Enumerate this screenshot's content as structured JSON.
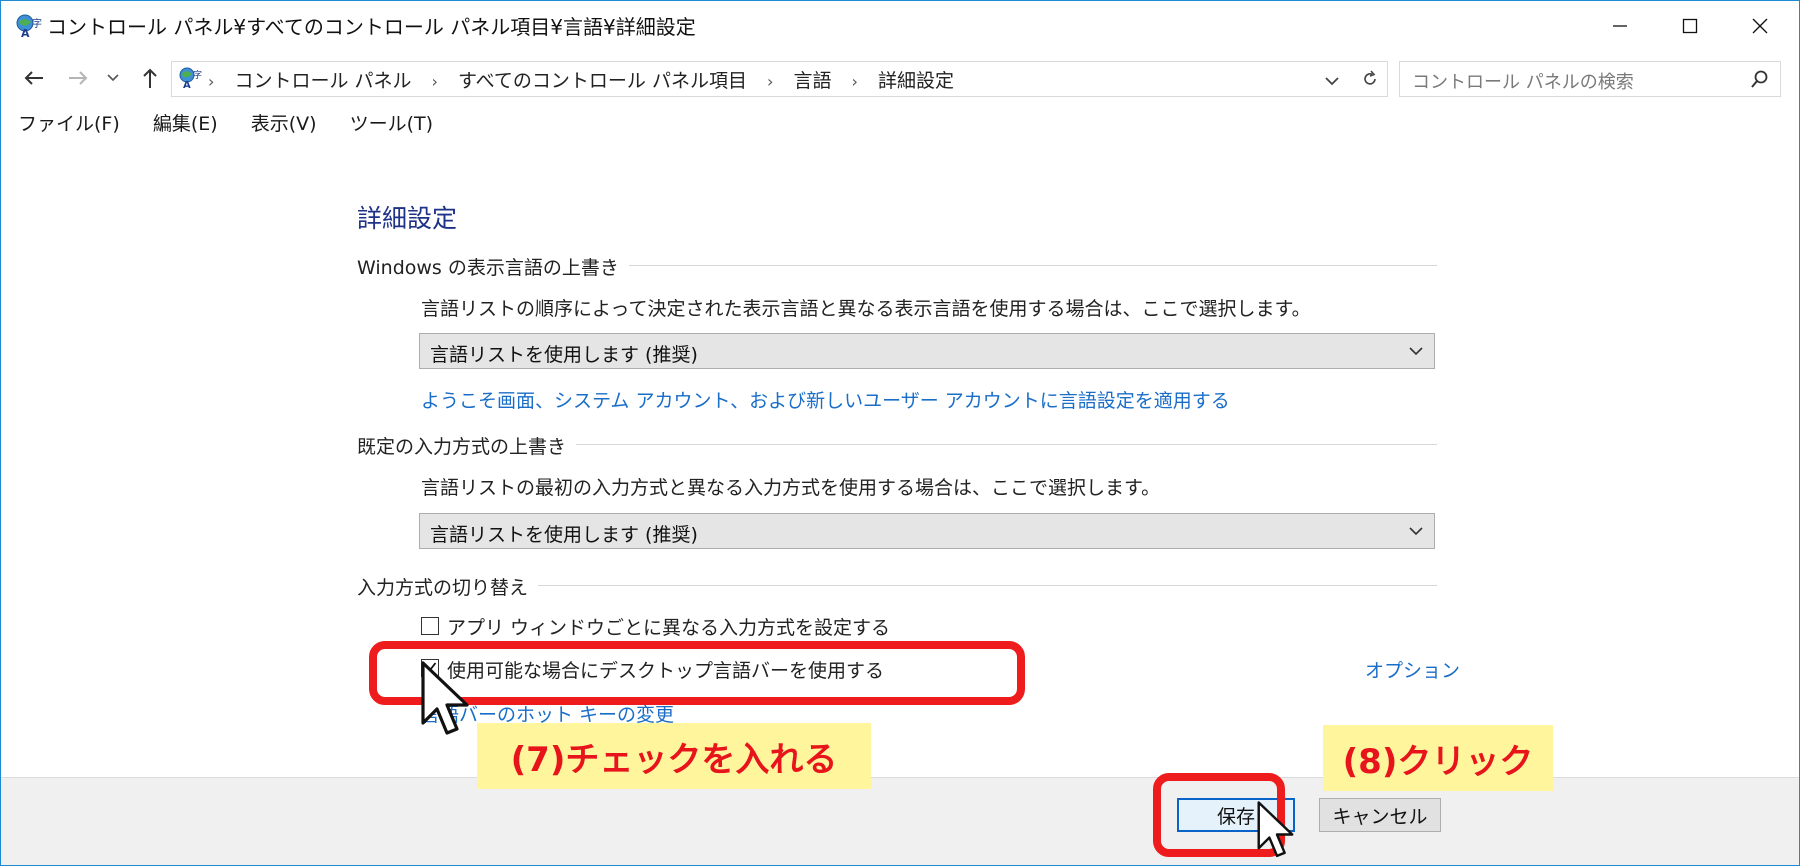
{
  "window": {
    "title": "コントロール パネル¥すべてのコントロール パネル項目¥言語¥詳細設定"
  },
  "address": {
    "crumbs": [
      "コントロール パネル",
      "すべてのコントロール パネル項目",
      "言語",
      "詳細設定"
    ],
    "search_placeholder": "コントロール パネルの検索"
  },
  "menu": [
    "ファイル(F)",
    "編集(E)",
    "表示(V)",
    "ツール(T)"
  ],
  "content": {
    "heading": "詳細設定",
    "display_override": {
      "label": "Windows の表示言語の上書き",
      "description": "言語リストの順序によって決定された表示言語と異なる表示言語を使用する場合は、ここで選択します。",
      "selected": "言語リストを使用します (推奨)",
      "link": "ようこそ画面、システム アカウント、および新しいユーザー アカウントに言語設定を適用する"
    },
    "input_override": {
      "label": "既定の入力方式の上書き",
      "description": "言語リストの最初の入力方式と異なる入力方式を使用する場合は、ここで選択します。",
      "selected": "言語リストを使用します (推奨)"
    },
    "switching": {
      "label": "入力方式の切り替え",
      "per_app_label": "アプリ ウィンドウごとに異なる入力方式を設定する",
      "per_app_checked": false,
      "langbar_label": "使用可能な場合にデスクトップ言語バーを使用する",
      "langbar_checked": true,
      "options_link": "オプション",
      "hotkey_link": "言語バーのホット キーの変更"
    }
  },
  "footer": {
    "save": "保存",
    "cancel": "キャンセル"
  },
  "annotations": {
    "step7": "(7)チェックを入れる",
    "step8": "(8)クリック"
  },
  "colors": {
    "accent_border": "#1f8ad2",
    "heading": "#1e3287",
    "link": "#1a6ec8",
    "highlight_red": "#ee1c1c",
    "callout_bg": "#fff59d"
  }
}
